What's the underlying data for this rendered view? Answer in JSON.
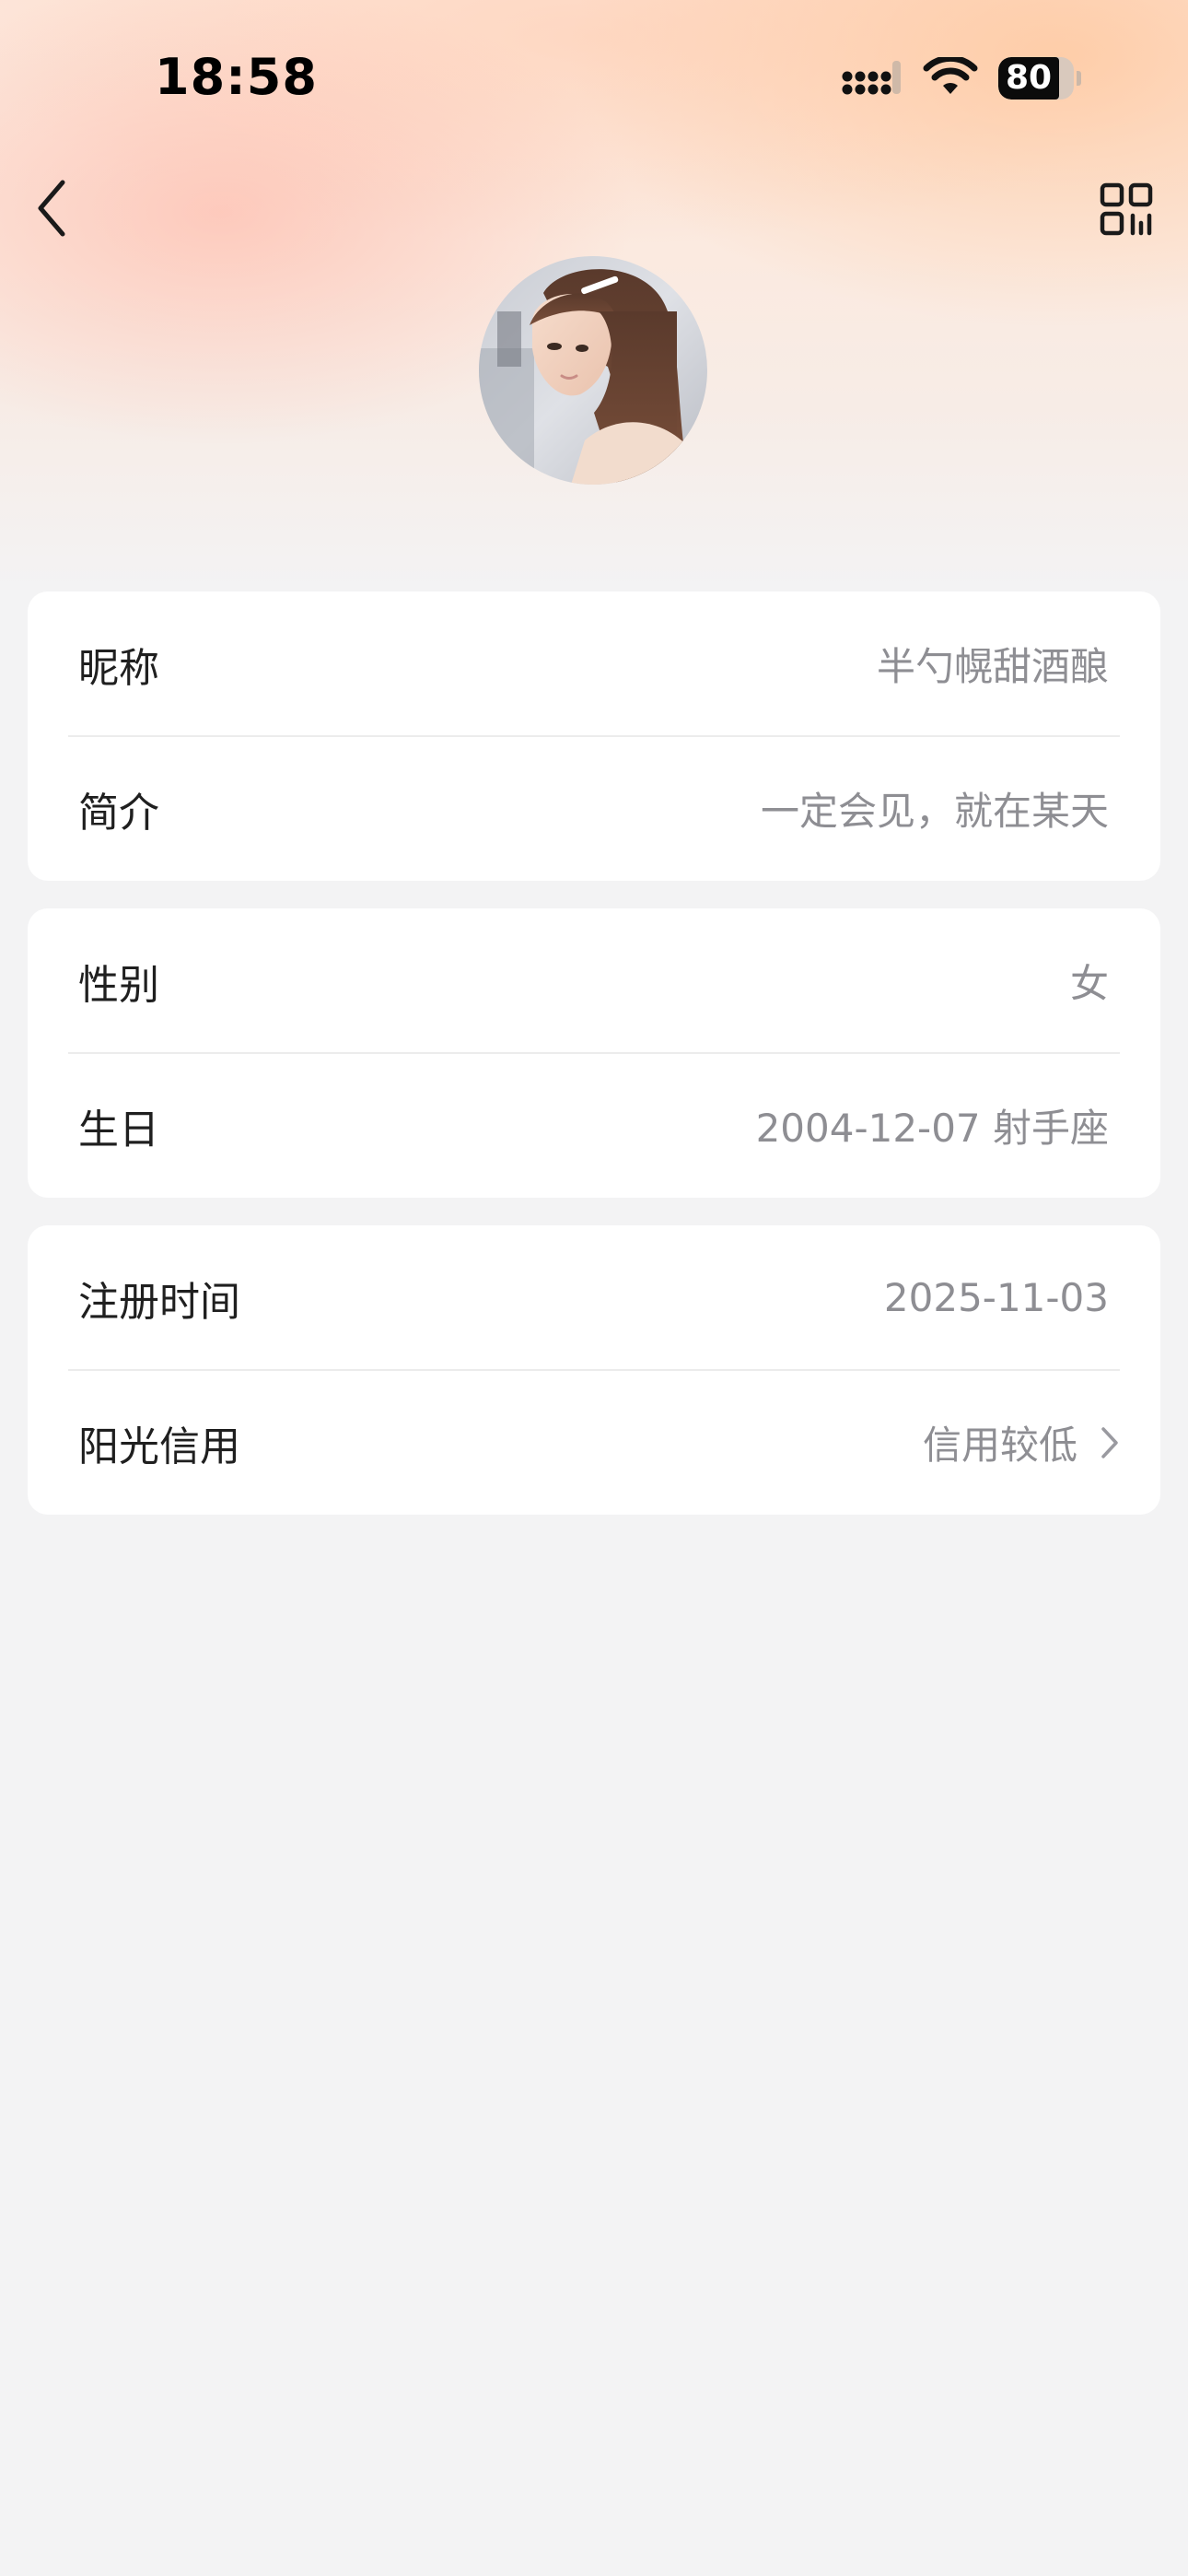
{
  "status_bar": {
    "time": "18:58",
    "battery_level": "80",
    "battery_fraction": 0.8
  },
  "nav": {
    "back_icon": "chevron-left-icon",
    "qr_icon": "qr-code-icon"
  },
  "avatar": {
    "icon": "avatar-photo"
  },
  "sections": [
    {
      "rows": [
        {
          "label": "昵称",
          "value": "半勺幌甜酒酿"
        },
        {
          "label": "简介",
          "value": "一定会见，就在某天"
        }
      ]
    },
    {
      "rows": [
        {
          "label": "性别",
          "value": "女"
        },
        {
          "label": "生日",
          "value": "2004-12-07 射手座"
        }
      ]
    },
    {
      "rows": [
        {
          "label": "注册时间",
          "value": "2025-11-03"
        },
        {
          "label": "阳光信用",
          "value": "信用较低"
        }
      ]
    }
  ],
  "colors": {
    "background": "#f3f3f4",
    "card": "#ffffff",
    "label": "#1f1f1f",
    "value": "#8e8e93",
    "header_gradient_top": "#fde5d9"
  }
}
